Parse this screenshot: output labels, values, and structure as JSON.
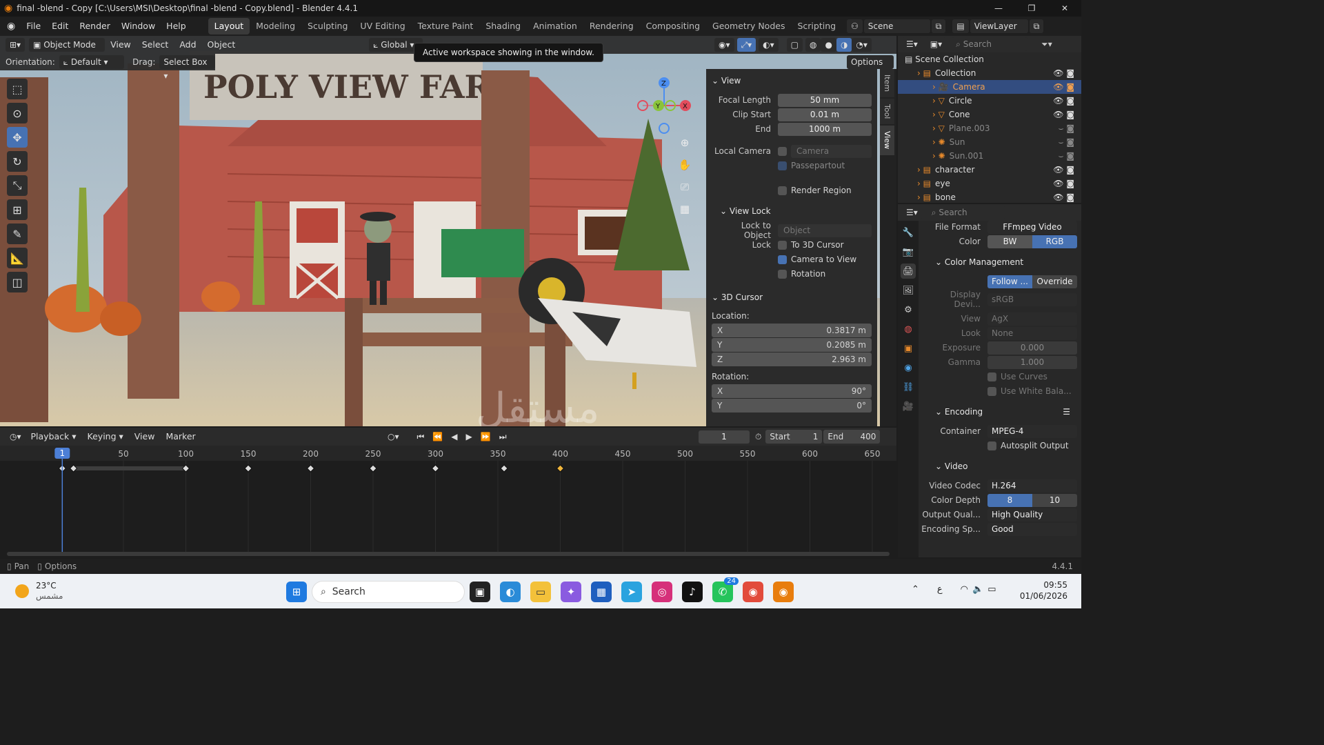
{
  "title": "final -blend - Copy [C:\\Users\\MSI\\Desktop\\final -blend - Copy.blend] - Blender 4.4.1",
  "menu": [
    "File",
    "Edit",
    "Render",
    "Window",
    "Help"
  ],
  "workspaces": [
    "Layout",
    "Modeling",
    "Sculpting",
    "UV Editing",
    "Texture Paint",
    "Shading",
    "Animation",
    "Rendering",
    "Compositing",
    "Geometry Nodes",
    "Scripting"
  ],
  "scene_label": "Scene",
  "viewlayer_label": "ViewLayer",
  "viewport_header": {
    "mode": "Object Mode",
    "view": "View",
    "select": "Select",
    "add": "Add",
    "object": "Object",
    "transform": "Global",
    "orientation_label": "Orientation:",
    "orientation": "Default",
    "drag_label": "Drag:",
    "drag": "Select Box",
    "options": "Options"
  },
  "tooltip": "Active workspace showing in the window.",
  "scene_sign": "POLY VIEW FARM",
  "npanel": {
    "view_title": "View",
    "focal_label": "Focal Length",
    "focal": "50 mm",
    "clip_start_label": "Clip Start",
    "clip_start": "0.01 m",
    "end_label": "End",
    "clip_end": "1000 m",
    "local_camera_label": "Local Camera",
    "local_camera": "Camera",
    "passepartout": "Passepartout",
    "render_region": "Render Region",
    "view_lock_title": "View Lock",
    "lock_obj_label": "Lock to Object",
    "lock_obj": "Object",
    "lock_label": "Lock",
    "to_cursor": "To 3D Cursor",
    "cam_to_view": "Camera to View",
    "rotation": "Rotation",
    "cursor_title": "3D Cursor",
    "location_label": "Location:",
    "x": "X",
    "y": "Y",
    "z": "Z",
    "loc_x": "0.3817 m",
    "loc_y": "0.2085 m",
    "loc_z": "2.963 m",
    "rotation_label": "Rotation:",
    "rot_x": "90°",
    "rot_y": "0°",
    "tabs": [
      "Item",
      "Tool",
      "View"
    ]
  },
  "outliner": {
    "search": "Search",
    "root": "Scene Collection",
    "items": [
      {
        "name": "Collection",
        "level": 0
      },
      {
        "name": "Camera",
        "level": 1
      },
      {
        "name": "Circle",
        "level": 1
      },
      {
        "name": "Cone",
        "level": 1
      },
      {
        "name": "Plane.003",
        "level": 1
      },
      {
        "name": "Sun",
        "level": 1
      },
      {
        "name": "Sun.001",
        "level": 1
      },
      {
        "name": "character",
        "level": 0
      },
      {
        "name": "eye",
        "level": 0
      },
      {
        "name": "bone",
        "level": 0
      }
    ]
  },
  "props": {
    "search": "Search",
    "file_format_label": "File Format",
    "file_format": "FFmpeg Video",
    "color_label": "Color",
    "bw": "BW",
    "rgb": "RGB",
    "color_mgmt": "Color Management",
    "follow": "Follow ...",
    "override": "Override",
    "display_label": "Display Devi...",
    "display": "sRGB",
    "view_label": "View",
    "view": "AgX",
    "look_label": "Look",
    "look": "None",
    "exposure_label": "Exposure",
    "exposure": "0.000",
    "gamma_label": "Gamma",
    "gamma": "1.000",
    "use_curves": "Use Curves",
    "use_white": "Use White Bala...",
    "encoding": "Encoding",
    "container_label": "Container",
    "container": "MPEG-4",
    "autosplit": "Autosplit Output",
    "video": "Video",
    "codec_label": "Video Codec",
    "codec": "H.264",
    "depth_label": "Color Depth",
    "depth8": "8",
    "depth10": "10",
    "quality_label": "Output Qual...",
    "quality": "High Quality",
    "speed_label": "Encoding Sp...",
    "speed": "Good"
  },
  "timeline": {
    "playback": "Playback",
    "keying": "Keying",
    "view": "View",
    "marker": "Marker",
    "current": "1",
    "start_label": "Start",
    "start": "1",
    "end_label": "End",
    "end": "400",
    "current_frame": 1,
    "ticks": [
      "50",
      "100",
      "150",
      "200",
      "250",
      "300",
      "350",
      "400",
      "450",
      "500",
      "550",
      "600",
      "650"
    ],
    "tick_values": [
      50,
      100,
      150,
      200,
      250,
      300,
      350,
      400,
      450,
      500,
      550,
      600,
      650
    ],
    "keyframes": [
      1,
      10,
      100,
      150,
      200,
      250,
      300,
      355,
      400
    ]
  },
  "status": {
    "pan": "Pan",
    "options": "Options",
    "version": "4.4.1"
  },
  "taskbar": {
    "temp": "23°C",
    "weather": "مشمس",
    "search": "Search",
    "time": "09:55",
    "date": "01/06/2026",
    "badge": "24",
    "lang": "ع"
  },
  "watermark": "مستقل"
}
